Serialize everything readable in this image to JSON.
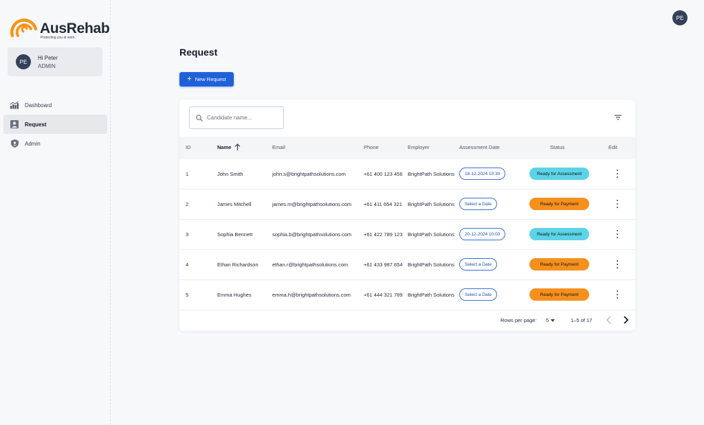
{
  "brand": {
    "name": "AusRehab",
    "tagline": "Protecting you at work.",
    "accent": "#f7941d"
  },
  "user": {
    "greeting": "Hi Peter",
    "role": "ADMIN",
    "initials": "PE"
  },
  "nav": [
    {
      "label": "Dashboard",
      "icon": "chart-icon",
      "active": false
    },
    {
      "label": "Request",
      "icon": "person-icon",
      "active": true
    },
    {
      "label": "Admin",
      "icon": "shield-icon",
      "active": false
    }
  ],
  "page": {
    "title": "Request",
    "new_button": "New Request"
  },
  "search": {
    "placeholder": "Candidate name..."
  },
  "table": {
    "columns": {
      "id": "ID",
      "name": "Name",
      "email": "Email",
      "phone": "Phone",
      "employer": "Employer",
      "date": "Assessment Date",
      "status": "Status",
      "edit": "Edit"
    },
    "rows": [
      {
        "id": "1",
        "name": "John Smith",
        "email": "john.s@brightpathsolutions.com",
        "phone": "+61 400 123 456",
        "employer": "BrightPath Solutions",
        "date": "18-12-2024 10:30",
        "status": "Ready for Assessment"
      },
      {
        "id": "2",
        "name": "James Mitchell",
        "email": "james.m@brightpathsolutions.com",
        "phone": "+61 411 654 321",
        "employer": "BrightPath Solutions",
        "date": "Select a Date",
        "status": "Ready for Payment"
      },
      {
        "id": "3",
        "name": "Sophia Bennett",
        "email": "sophia.b@brightpathsolutions.com",
        "phone": "+61 422 789 123",
        "employer": "BrightPath Solutions",
        "date": "20-12-2024 10:00",
        "status": "Ready for Assessment"
      },
      {
        "id": "4",
        "name": "Ethan Richardson",
        "email": "ethan.r@brightpathsolutions.com",
        "phone": "+61 433 987 654",
        "employer": "BrightPath Solutions",
        "date": "Select a Date",
        "status": "Ready for Payment"
      },
      {
        "id": "5",
        "name": "Emma Hughes",
        "email": "emma.h@brightpathsolutions.com",
        "phone": "+61 444 321 789",
        "employer": "BrightPath Solutions",
        "date": "Select a Date",
        "status": "Ready for Payment"
      }
    ]
  },
  "pagination": {
    "rows_per_page_label": "Rows per page:",
    "rows_per_page": "5",
    "range": "1–5 of 17"
  },
  "colors": {
    "primary": "#1f61d9",
    "assessment": "#5dd3e8",
    "payment": "#f5901e"
  }
}
